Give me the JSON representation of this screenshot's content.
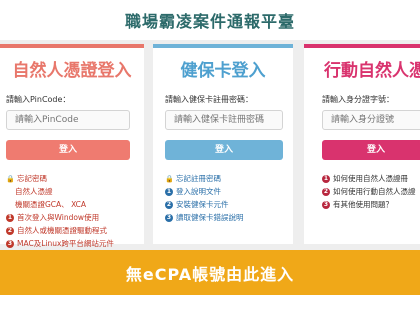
{
  "header": {
    "title": "職場霸凌案件通報平臺"
  },
  "cards": [
    {
      "title": "自然人憑證登入",
      "field_label": "請輸入PinCode：",
      "placeholder": "請輸入PinCode",
      "button_label": "登入",
      "links": [
        {
          "icon": "lock-icon",
          "text": "忘記密碼"
        },
        {
          "icon": "",
          "text": "自然人憑證",
          "indent": true
        },
        {
          "icon": "",
          "text": "機關憑證GCA、 XCA",
          "indent": true
        },
        {
          "icon": "number-1-icon",
          "badge": "1",
          "text": "首次登入與Window使用"
        },
        {
          "icon": "number-2-icon",
          "badge": "2",
          "text": "自然人或機關憑證驅動程式"
        },
        {
          "icon": "number-3-icon",
          "badge": "3",
          "text": "MAC及Linux跨平台網站元件"
        }
      ]
    },
    {
      "title": "健保卡登入",
      "field_label": "請輸入健保卡註冊密碼：",
      "placeholder": "請輸入健保卡註冊密碼",
      "button_label": "登入",
      "links": [
        {
          "icon": "lock-icon",
          "text": "忘記註冊密碼"
        },
        {
          "icon": "number-1-icon",
          "badge": "1",
          "text": "登入說明文件"
        },
        {
          "icon": "number-2-icon",
          "badge": "2",
          "text": "安裝健保卡元件"
        },
        {
          "icon": "number-3-icon",
          "badge": "3",
          "text": "讀取健保卡錯誤說明"
        }
      ]
    },
    {
      "title": "行動自然人憑",
      "field_label": "請輸入身分證字號：",
      "placeholder": "請輸入身分證號",
      "button_label": "登入",
      "links": [
        {
          "icon": "number-1-icon",
          "badge": "1",
          "text": "如何使用自然人憑證冊"
        },
        {
          "icon": "number-2-icon",
          "badge": "2",
          "text": "如何使用行動自然人憑證"
        },
        {
          "icon": "number-3-icon",
          "badge": "3",
          "text": "有其他使用問題？"
        }
      ]
    }
  ],
  "footer": {
    "label": "無eCPA帳號由此進入"
  },
  "colors": {
    "header_text": "#2c6a6a",
    "citizen_accent": "#e8776b",
    "nhi_accent": "#6fb3d8",
    "mobile_accent": "#d9336e",
    "footer_bg": "#f0a818"
  }
}
